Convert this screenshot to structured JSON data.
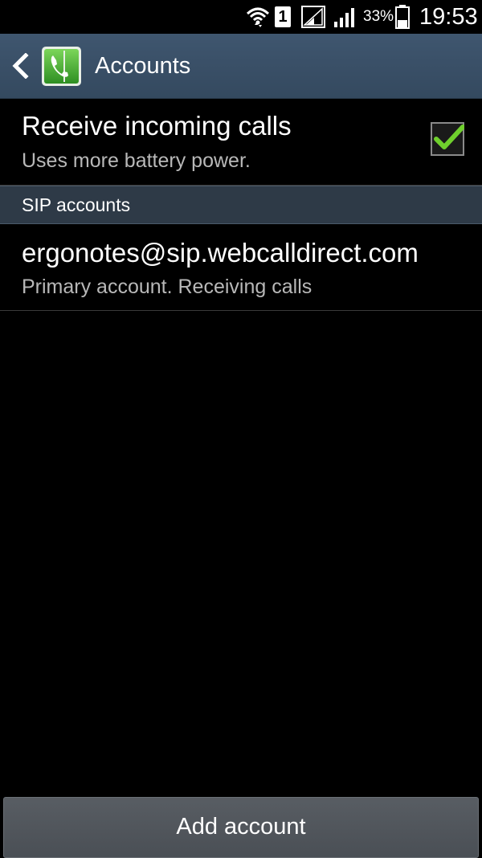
{
  "status_bar": {
    "sim_slot": "1",
    "battery_percent": "33%",
    "time": "19:53",
    "icons": [
      "wifi-icon",
      "sim-icon",
      "signal-icon",
      "signal-icon",
      "battery-icon"
    ]
  },
  "action_bar": {
    "title": "Accounts",
    "icons": [
      "back-icon",
      "phone-app-icon"
    ]
  },
  "receive_calls": {
    "title": "Receive incoming calls",
    "summary": "Uses more battery power.",
    "checked": true,
    "check_color": "#6fcf2d"
  },
  "sip_section": {
    "header": "SIP accounts",
    "accounts": [
      {
        "address": "ergonotes@sip.webcalldirect.com",
        "status": "Primary account. Receiving calls"
      }
    ]
  },
  "footer": {
    "add_account_label": "Add account"
  },
  "colors": {
    "action_bar": "#3a4f66",
    "section_header": "#2e3a47",
    "background": "#000000",
    "app_icon_green": "#4caf3a"
  }
}
